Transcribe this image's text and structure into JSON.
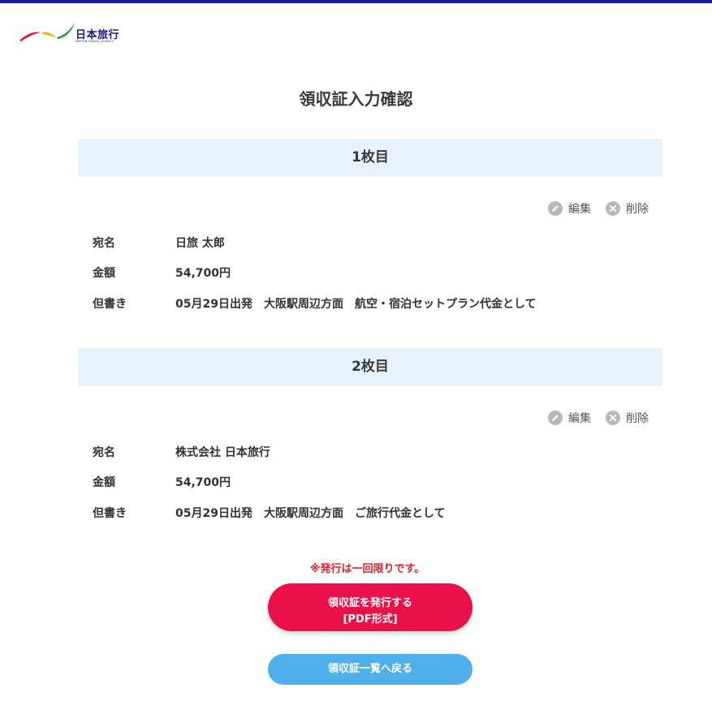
{
  "brand": {
    "name": "日本旅行",
    "sub": "NIPPON TRAVEL AGENCY",
    "bar_color": "#1a1aa6"
  },
  "page": {
    "title": "領収証入力確認"
  },
  "receipts": [
    {
      "heading": "1枚目",
      "edit_label": "編集",
      "delete_label": "削除",
      "addressee_label": "宛名",
      "addressee": "日旅 太郎",
      "amount_label": "金額",
      "amount": "54,700円",
      "memo_label": "但書き",
      "memo": "05月29日出発　大阪駅周辺方面　航空・宿泊セットプラン代金として"
    },
    {
      "heading": "2枚目",
      "edit_label": "編集",
      "delete_label": "削除",
      "addressee_label": "宛名",
      "addressee": "株式会社 日本旅行",
      "amount_label": "金額",
      "amount": "54,700円",
      "memo_label": "但書き",
      "memo": "05月29日出発　大阪駅周辺方面　ご旅行代金として"
    }
  ],
  "notice": "※発行は一回限りです。",
  "issue_button": {
    "line1": "領収証を発行する",
    "line2": "[PDF形式]",
    "color": "#ec1048"
  },
  "back_button": {
    "label": "領収証一覧へ戻る",
    "color": "#4fb0ec"
  },
  "icons": {
    "edit": "pencil-icon",
    "delete": "close-circle-icon"
  }
}
